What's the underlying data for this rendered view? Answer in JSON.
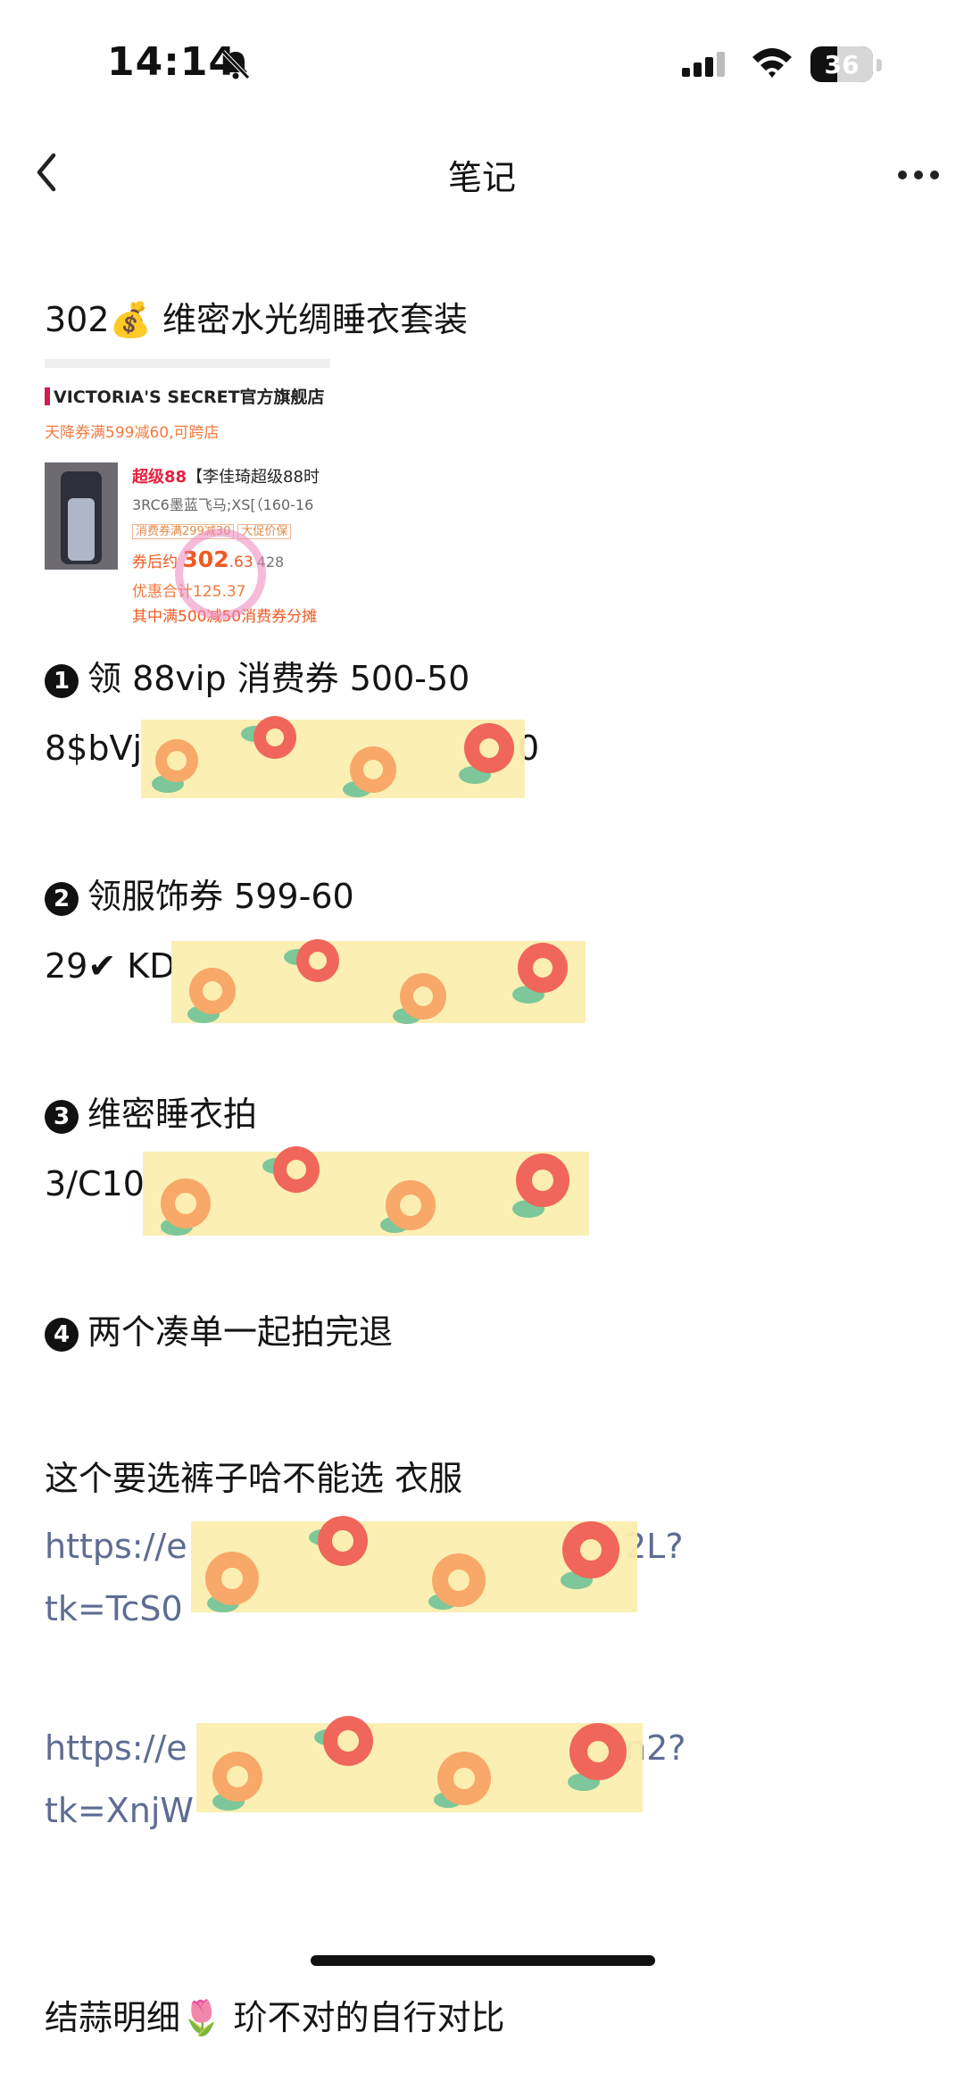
{
  "status_bar": {
    "time": "14:14",
    "battery": "36"
  },
  "header": {
    "title": "笔记"
  },
  "note": {
    "heading_price": "302",
    "heading_emoji": "💰",
    "heading_text": "维密水光绸睡衣套装",
    "product_screenshot": {
      "store": "VICTORIA'S SECRET官方旗舰店",
      "promo": "天降券满599减60,可跨店",
      "tag": "超级88",
      "product_title": "【李佳琦超级88时",
      "sku": "3RC6墨蓝飞马;XS[（160-16",
      "coupon_chips": [
        "消费券满299减30",
        "大促价保"
      ],
      "after_coupon_label": "券后约",
      "price_main": "302",
      "price_decimal": ".63",
      "price_gray": "428",
      "discount": "优惠合计125.37",
      "detail": "其中满500减50消费券分摊"
    },
    "steps": [
      {
        "num": "1",
        "text": "领 88vip 消费券 500-50",
        "code": "8$bVj",
        "code_tail": "0"
      },
      {
        "num": "2",
        "text": "领服饰券 599-60",
        "code": "29✔ KD"
      },
      {
        "num": "3",
        "text": "维密睡衣拍",
        "code": "3/C10"
      },
      {
        "num": "4",
        "text": "两个凑单一起拍完退"
      }
    ],
    "note_pants": "这个要选裤子哈不能选 衣服",
    "link1_line1": "https://e",
    "link1_tail": "2L?",
    "link1_line2": "tk=TcS0",
    "link2_line1": "https://e",
    "link2_tail": "n2?",
    "link2_line2": "tk=XnjW",
    "footer_text_a": "结蒜明细",
    "footer_emoji": "🌷",
    "footer_text_b": "玠不对的自行对比"
  },
  "colors": {
    "link": "#5e6c92",
    "tape_bg": "#fbeeb0",
    "flower_red": "#f0665a",
    "flower_orange": "#f8a868",
    "leaf": "#7dc79a"
  },
  "icons": [
    "back-icon",
    "bell-off-icon",
    "signal-icon",
    "wifi-icon",
    "battery-icon",
    "more-icon",
    "flower-tape-sticker"
  ]
}
